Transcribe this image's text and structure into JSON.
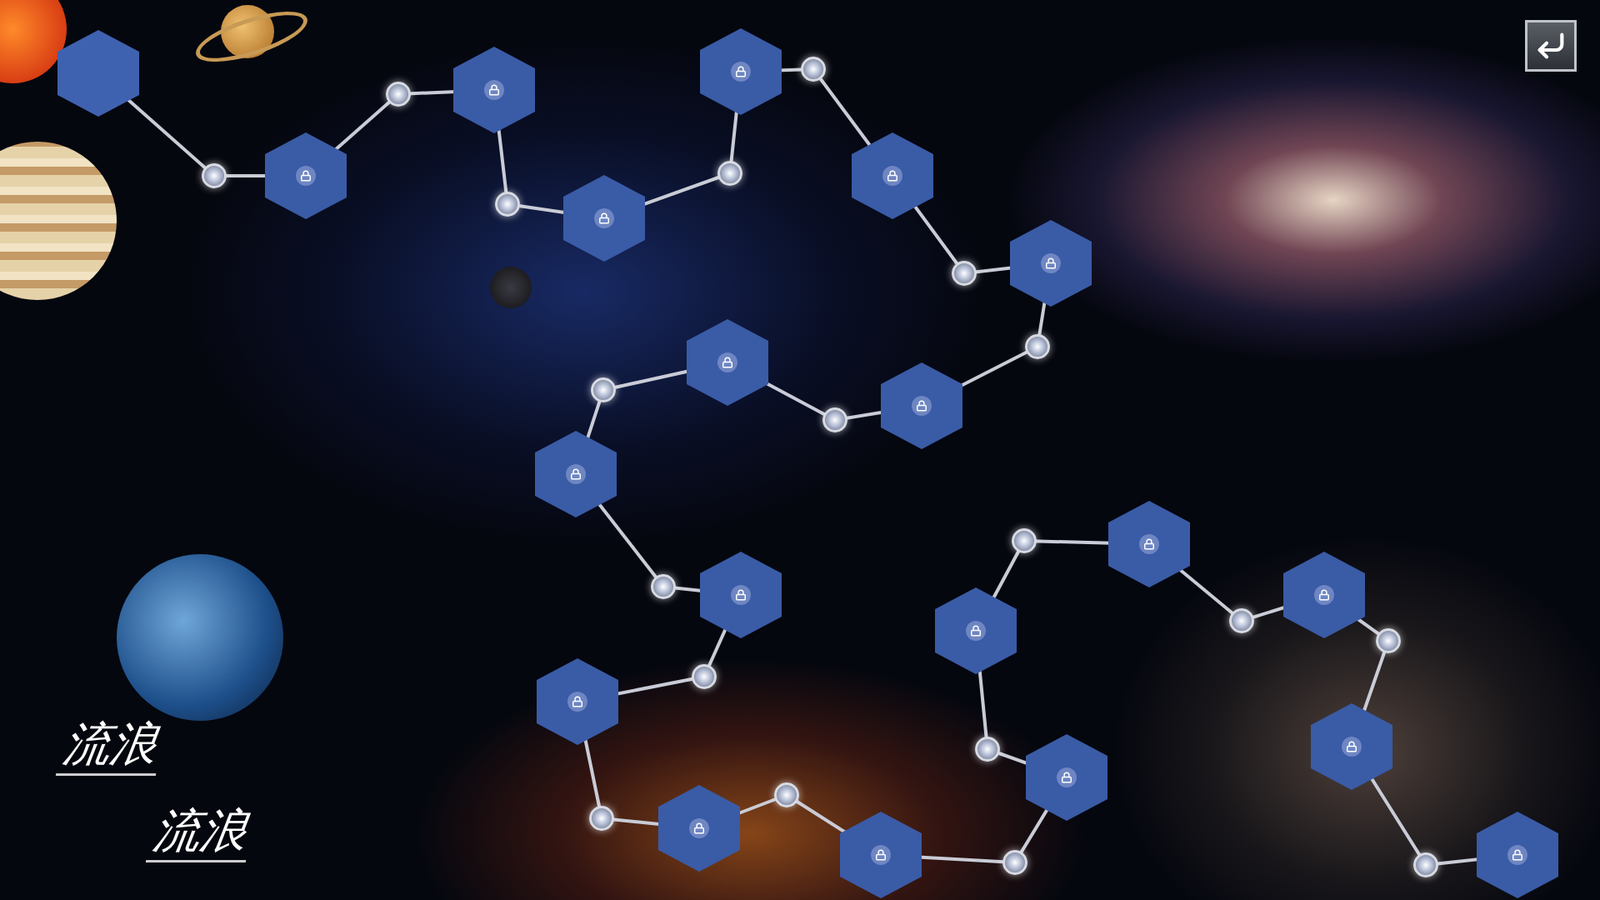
{
  "screen": {
    "name": "level-map"
  },
  "logo": [
    "流浪",
    "流浪"
  ],
  "levels": [
    {
      "locked": false
    },
    {
      "locked": true
    },
    {
      "locked": true
    },
    {
      "locked": true
    },
    {
      "locked": true
    },
    {
      "locked": true
    },
    {
      "locked": true
    },
    {
      "locked": true
    },
    {
      "locked": true
    },
    {
      "locked": true
    },
    {
      "locked": true
    },
    {
      "locked": true
    },
    {
      "locked": true
    },
    {
      "locked": true
    },
    {
      "locked": true
    },
    {
      "locked": true
    },
    {
      "locked": true
    },
    {
      "locked": true
    },
    {
      "locked": true
    },
    {
      "locked": true
    }
  ]
}
